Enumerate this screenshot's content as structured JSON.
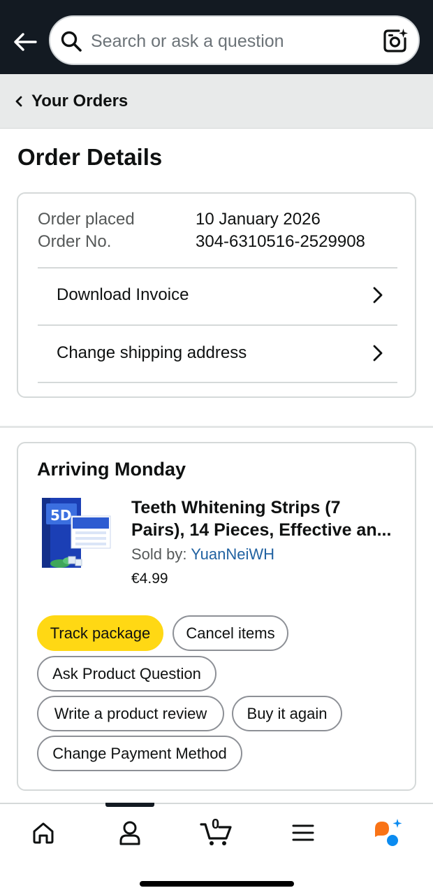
{
  "header": {
    "search_placeholder": "Search or ask a question"
  },
  "breadcrumb": {
    "label": "Your Orders"
  },
  "page_title": "Order Details",
  "order_info": {
    "placed_label": "Order placed",
    "placed_value": "10 January 2026",
    "number_label": "Order No.",
    "number_value": "304-6310516-2529908",
    "links": [
      {
        "label": "Download Invoice"
      },
      {
        "label": "Change shipping address"
      }
    ]
  },
  "shipment": {
    "status": "Arriving Monday",
    "product": {
      "title_line1": "Teeth Whitening Strips (7",
      "title_line2": "Pairs), 14 Pieces, Effective an...",
      "sold_by_label": "Sold by:",
      "seller": "YuanNeiWH",
      "price": "€4.99"
    },
    "actions": {
      "track": "Track package",
      "cancel": "Cancel items",
      "ask": "Ask Product Question",
      "review": "Write a product review",
      "buy_again": "Buy it again",
      "payment": "Change Payment Method"
    }
  },
  "bottom_nav": {
    "items": [
      "home-icon",
      "account-icon",
      "cart-icon",
      "menu-icon",
      "rufus-icon"
    ],
    "cart_count": "0",
    "active": "account"
  },
  "colors": {
    "header_bg": "#131a22",
    "primary_button": "#ffd814",
    "link": "#2162a1",
    "assistant_orange": "#f97316",
    "assistant_blue": "#0b8bf0"
  }
}
